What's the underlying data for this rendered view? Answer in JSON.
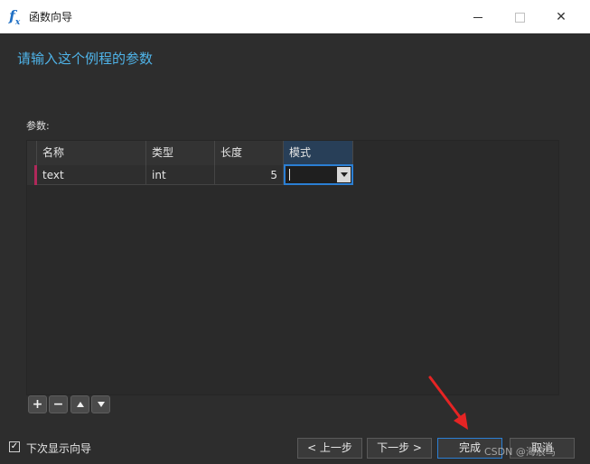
{
  "window": {
    "app_icon": "fx-function-icon",
    "title": "函数向导",
    "controls": [
      "minimize-icon",
      "maximize-icon",
      "close-icon"
    ]
  },
  "heading": "请输入这个例程的参数",
  "params_label": "参数:",
  "grid": {
    "columns": [
      "名称",
      "类型",
      "长度",
      "模式"
    ],
    "rows": [
      {
        "name": "text",
        "type": "int",
        "length": "5",
        "mode": ""
      }
    ],
    "toolbar": [
      "plus-icon",
      "minus-icon",
      "arrow-up-icon",
      "arrow-down-icon"
    ]
  },
  "show_wizard_checkbox": {
    "checked": true,
    "label": "下次显示向导"
  },
  "buttons": {
    "prev": "< 上一步",
    "next": "下一步 >",
    "finish": "完成",
    "cancel": "取消"
  },
  "watermark": "CSDN @海浪鸟",
  "colors": {
    "accent": "#4fb3e8",
    "focus_border": "#2b7fd4",
    "active_header": "#283f58",
    "row_marker": "#b0285a",
    "annotation_arrow": "#e52424"
  }
}
